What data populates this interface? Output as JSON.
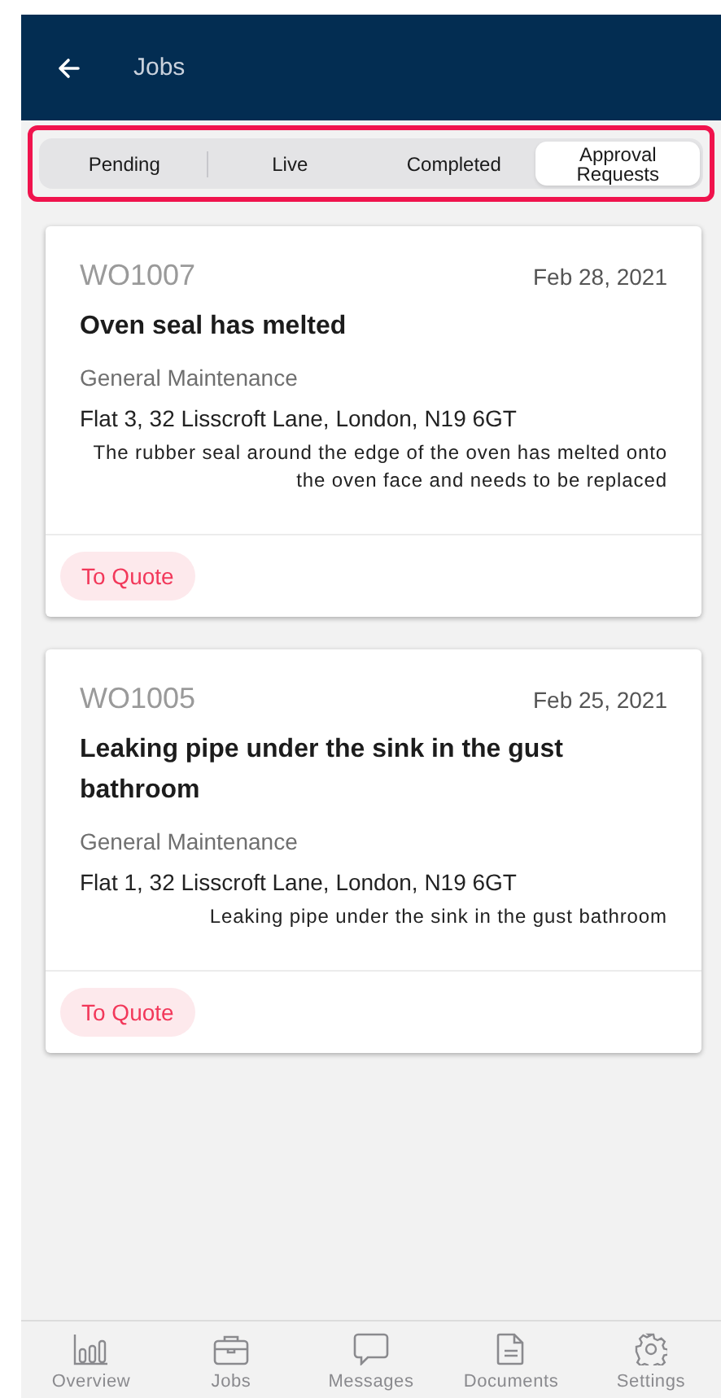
{
  "header": {
    "title": "Jobs"
  },
  "tabs": [
    {
      "label": "Pending",
      "selected": false
    },
    {
      "label": "Live",
      "selected": false
    },
    {
      "label": "Completed",
      "selected": false
    },
    {
      "label": "Approval Requests",
      "selected": true
    }
  ],
  "jobs": [
    {
      "number": "WO1007",
      "date": "Feb 28, 2021",
      "title": "Oven seal has melted",
      "category": "General Maintenance",
      "address": "Flat 3, 32 Lisscroft Lane, London, N19 6GT",
      "description": "The rubber seal around the edge of the oven has melted onto the oven face and needs to be replaced",
      "status": "To Quote"
    },
    {
      "number": "WO1005",
      "date": "Feb 25, 2021",
      "title": "Leaking pipe under the sink in the gust bathroom",
      "category": "General Maintenance",
      "address": "Flat 1, 32 Lisscroft Lane, London, N19 6GT",
      "description": "Leaking pipe under the sink in the gust bathroom",
      "status": "To Quote"
    }
  ],
  "nav": [
    {
      "label": "Overview",
      "kind": "chart"
    },
    {
      "label": "Jobs",
      "kind": "briefcase"
    },
    {
      "label": "Messages",
      "kind": "chat"
    },
    {
      "label": "Documents",
      "kind": "document"
    },
    {
      "label": "Settings",
      "kind": "gear"
    }
  ]
}
